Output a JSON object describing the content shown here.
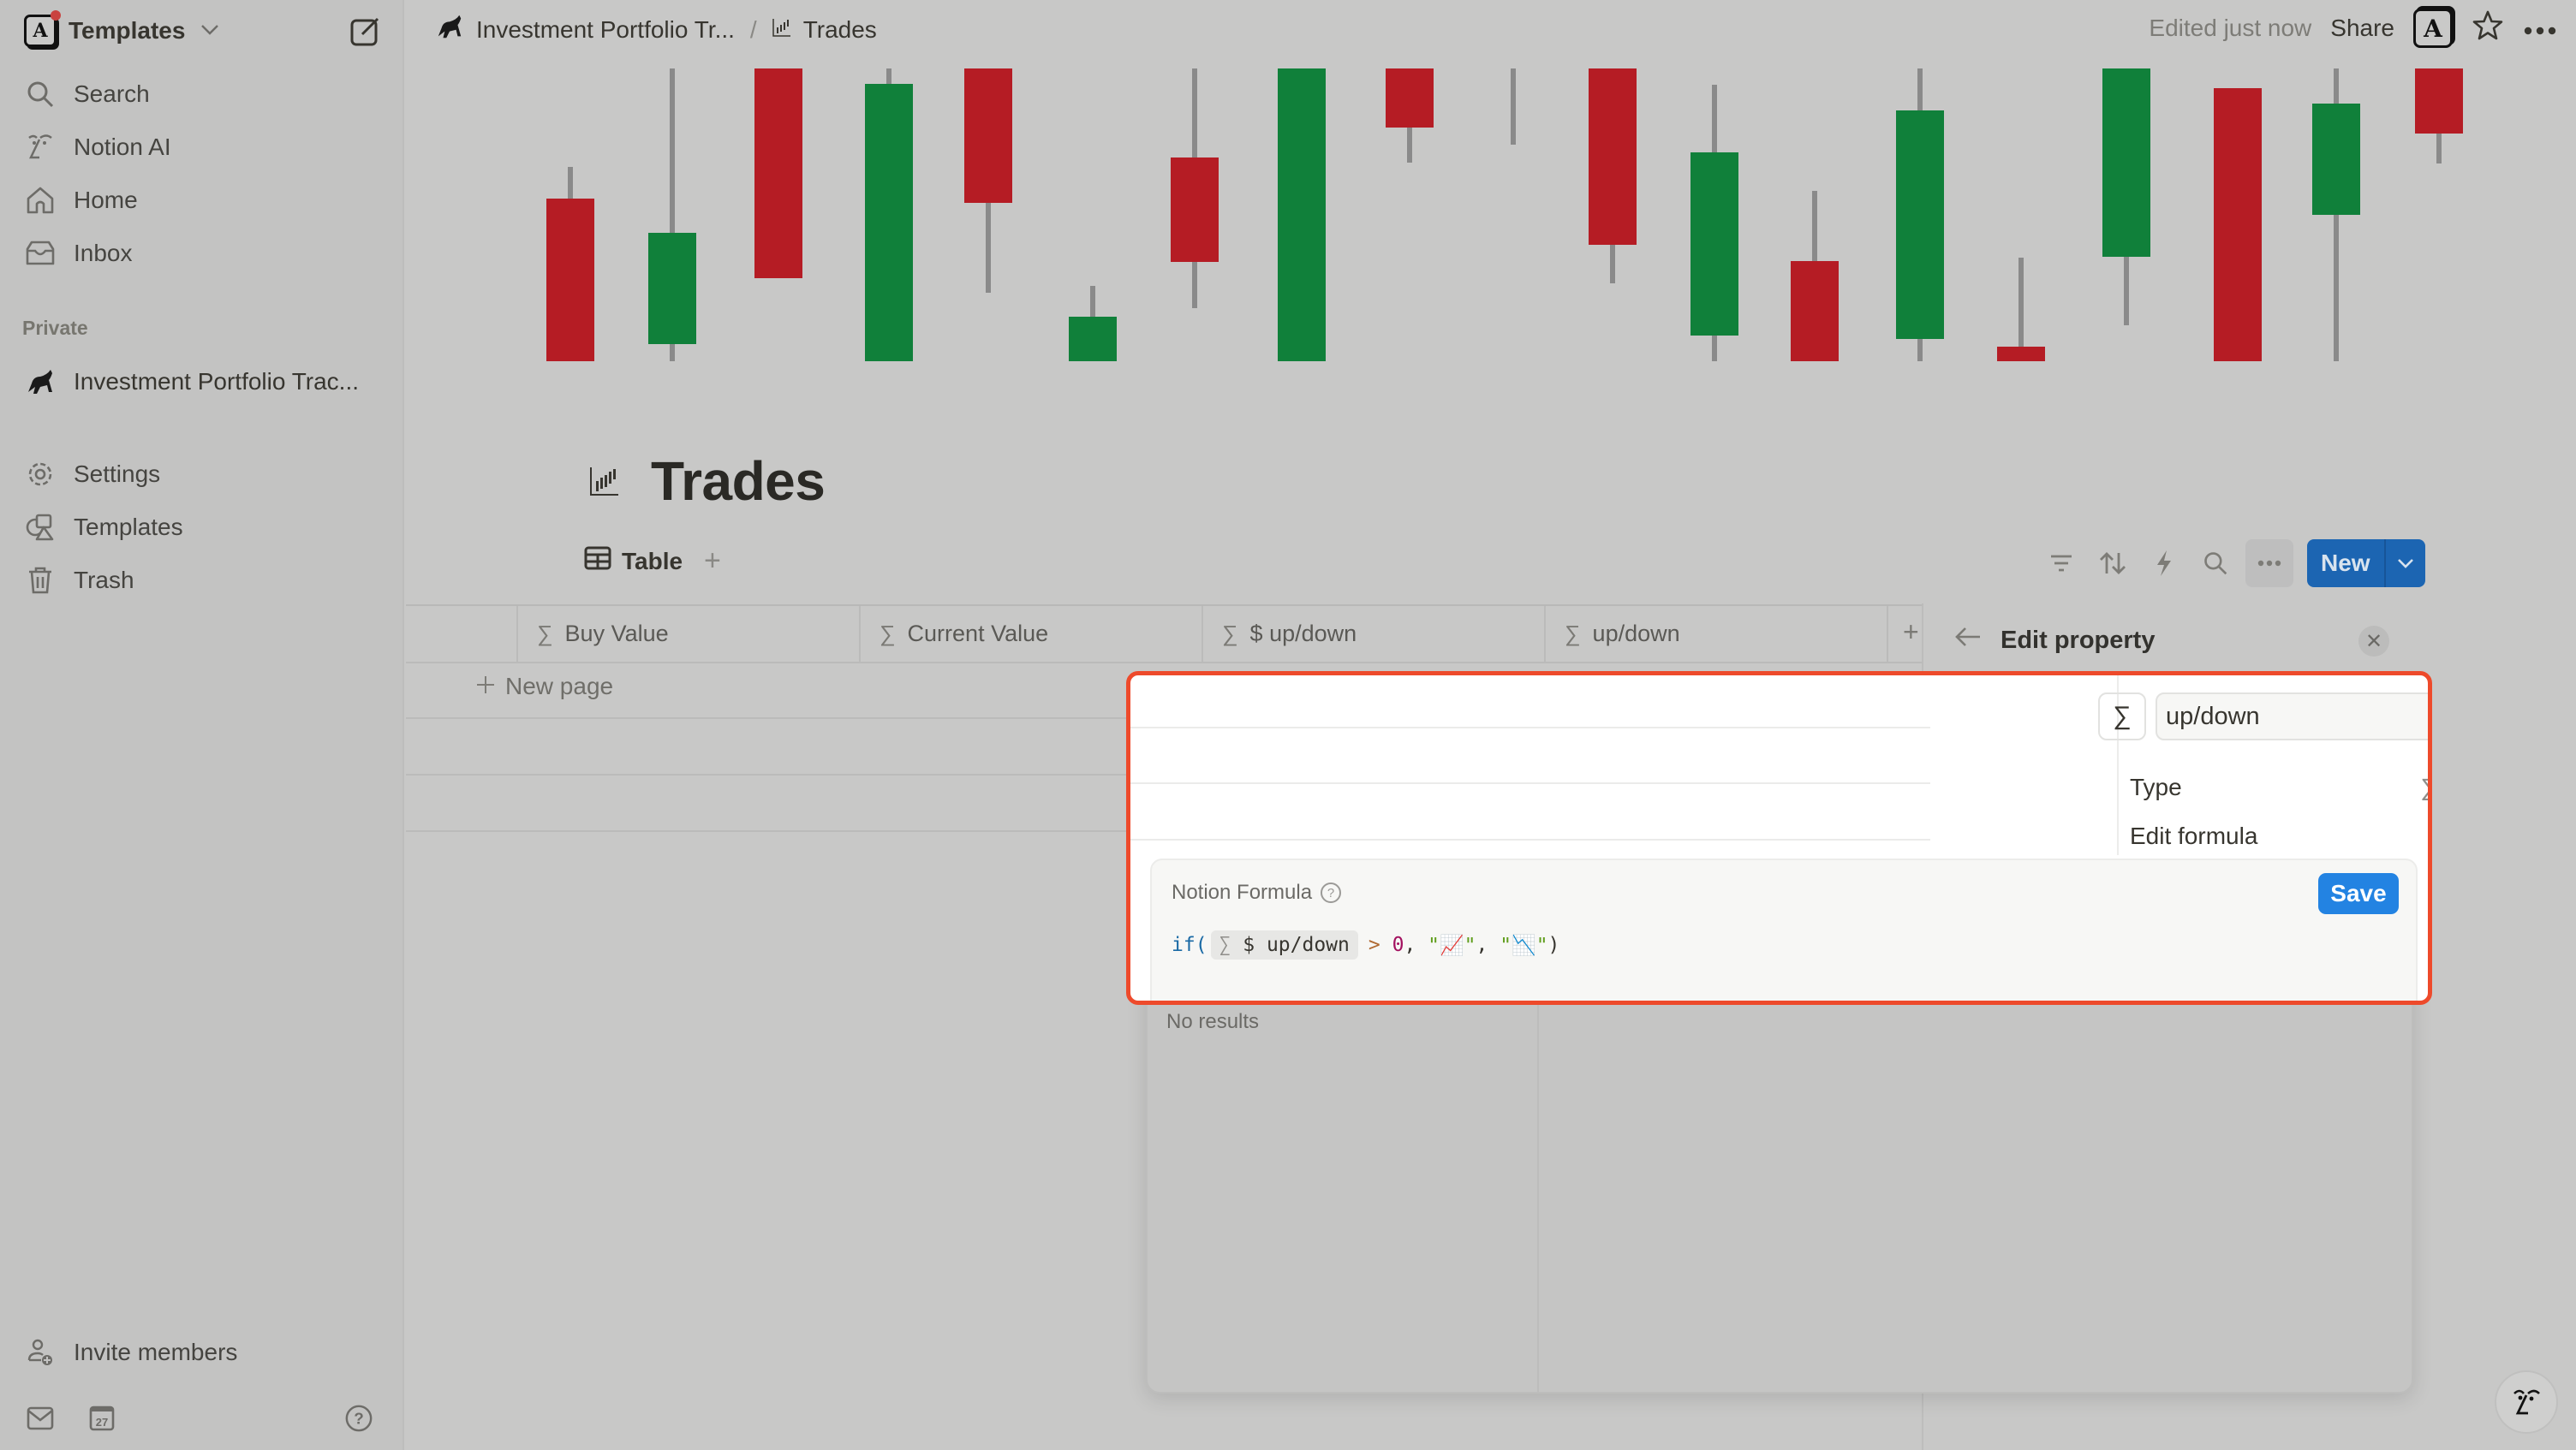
{
  "sidebar": {
    "workspace_name": "Templates",
    "nav": [
      {
        "label": "Search",
        "icon": "search-icon"
      },
      {
        "label": "Notion AI",
        "icon": "notion-ai-icon"
      },
      {
        "label": "Home",
        "icon": "home-icon"
      },
      {
        "label": "Inbox",
        "icon": "inbox-icon"
      }
    ],
    "section_private": "Private",
    "private_pages": [
      {
        "label": "Investment Portfolio Trac...",
        "icon": "bull-icon"
      }
    ],
    "footer_nav": [
      {
        "label": "Settings",
        "icon": "gear-icon"
      },
      {
        "label": "Templates",
        "icon": "templates-icon"
      },
      {
        "label": "Trash",
        "icon": "trash-icon"
      }
    ],
    "invite_label": "Invite members",
    "calendar_day": "27"
  },
  "topbar": {
    "breadcrumb": [
      {
        "label": "Investment Portfolio Tr...",
        "icon": "bull-icon"
      },
      {
        "label": "Trades",
        "icon": "candlestick-chart-icon"
      }
    ],
    "separator": "/",
    "edited_status": "Edited just now",
    "share_label": "Share",
    "avatar_letter": "A"
  },
  "cover": {
    "description": "Decorative candlestick cover image",
    "colors": {
      "up": "#10803a",
      "down": "#b51c24",
      "wick": "#8a8a8a"
    }
  },
  "page": {
    "title": "Trades",
    "view_tab": "Table",
    "add_view": "+",
    "new_button": "New",
    "columns": [
      {
        "label": "Buy Value",
        "icon": "sigma-icon"
      },
      {
        "label": "Current Value",
        "icon": "sigma-icon"
      },
      {
        "label": "$ up/down",
        "icon": "sigma-icon"
      },
      {
        "label": "up/down",
        "icon": "sigma-icon"
      }
    ],
    "add_column": "+",
    "new_page_label": "New page"
  },
  "edit_property": {
    "title": "Edit property",
    "property_name": "up/down",
    "type_label": "Type",
    "type_value": "Formula",
    "edit_formula_label": "Edit formula"
  },
  "formula_editor": {
    "label": "Notion Formula",
    "save_label": "Save",
    "code": {
      "fn": "if(",
      "token": "$ up/down",
      "op": ">",
      "num": "0",
      "sep": ", ",
      "str_true": "\"📈\"",
      "str_false": "\"📉\"",
      "close": ")"
    },
    "no_results": "No results"
  },
  "colors": {
    "accent_blue": "#2383e2",
    "new_button": "#1c65b2",
    "highlight_border": "#ee4a2b"
  }
}
